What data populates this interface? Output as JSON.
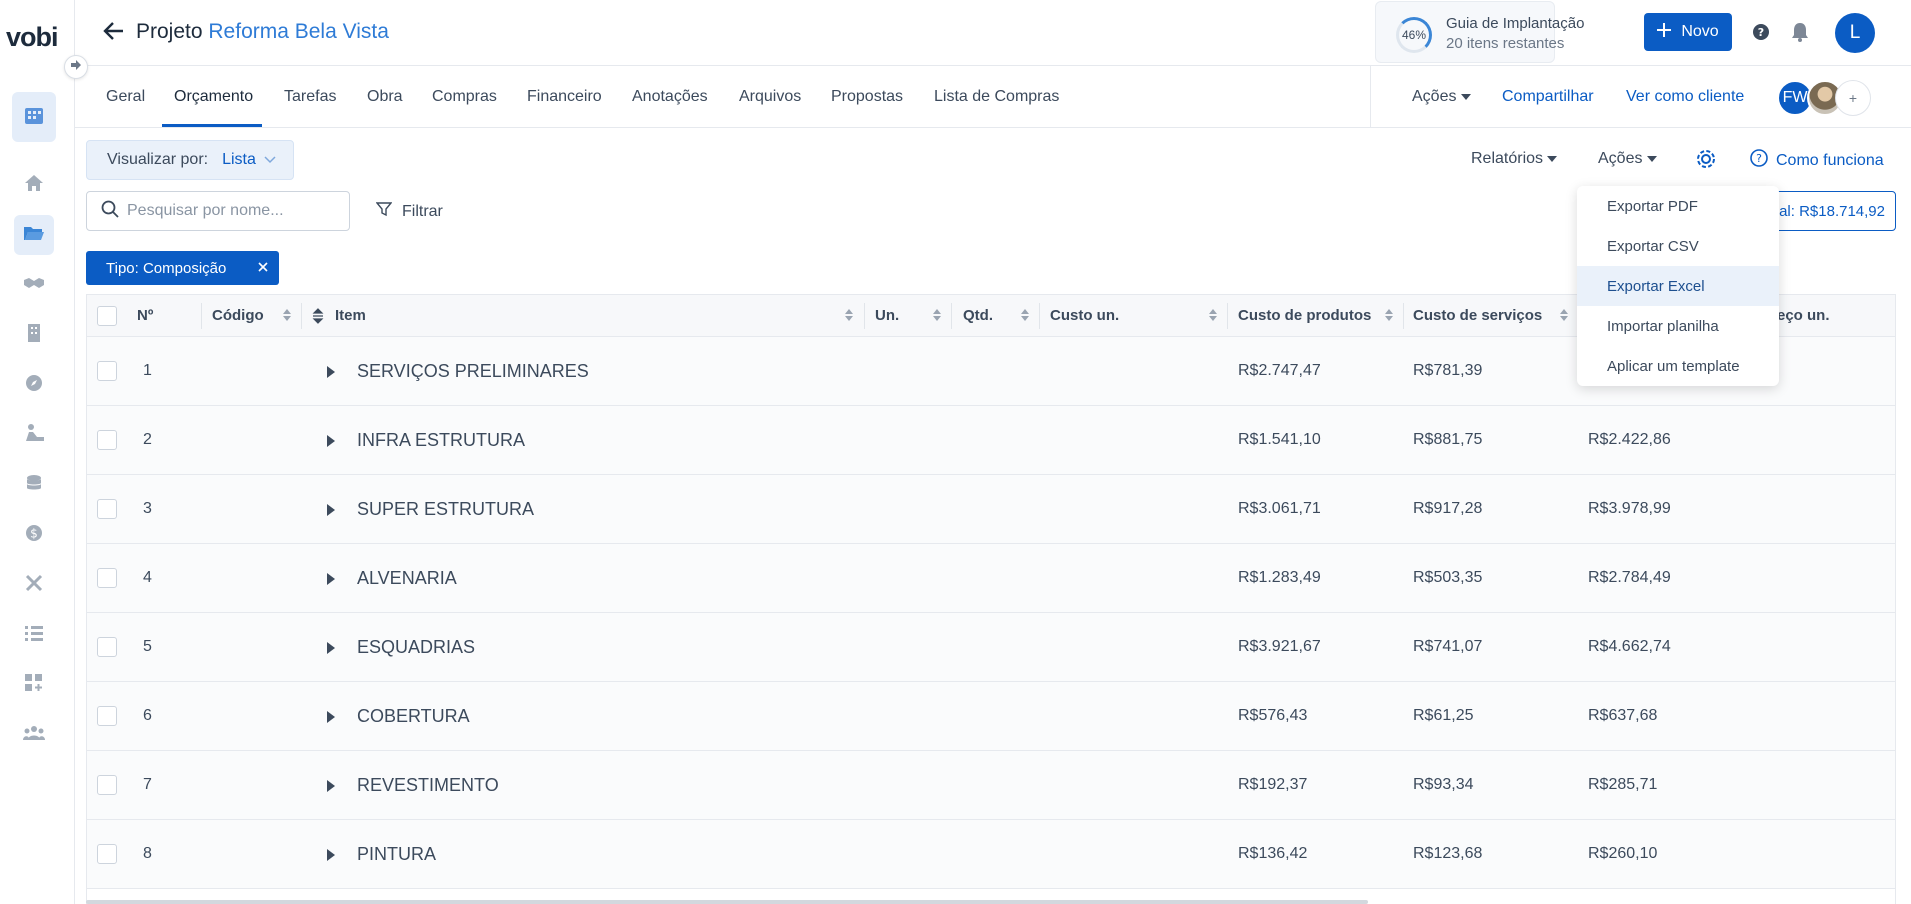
{
  "app": {
    "logo": "vobi"
  },
  "header": {
    "project_prefix": "Projeto",
    "project_name": "Reforma Bela Vista",
    "guide": {
      "percent": "46%",
      "title": "Guia de Implantação",
      "subtitle": "20 itens restantes"
    },
    "new_button": "Novo",
    "user_initial": "L"
  },
  "tabs": {
    "items": [
      "Geral",
      "Orçamento",
      "Tarefas",
      "Obra",
      "Compras",
      "Financeiro",
      "Anotações",
      "Arquivos",
      "Propostas",
      "Lista de Compras"
    ],
    "active": "Orçamento",
    "actions_label": "Ações",
    "share_label": "Compartilhar",
    "view_as_client_label": "Ver como cliente",
    "avatar_initials": "FW",
    "avatar_more": "+"
  },
  "toolbar": {
    "view_by_label": "Visualizar por:",
    "view_by_value": "Lista",
    "reports_label": "Relatórios",
    "actions_label": "Ações",
    "how_it_works": "Como funciona",
    "search_placeholder": "Pesquisar por nome...",
    "filter_label": "Filtrar",
    "total_label": "al: R$18.714,92",
    "chip_label": "Tipo: Composição"
  },
  "dropdown": {
    "items": [
      "Exportar PDF",
      "Exportar CSV",
      "Exportar Excel",
      "Importar planilha",
      "Aplicar um template"
    ],
    "highlighted": "Exportar Excel"
  },
  "table": {
    "columns": [
      "Nº",
      "Código",
      "Item",
      "Un.",
      "Qtd.",
      "Custo un.",
      "Custo de produtos",
      "Custo de serviços",
      "eço un."
    ],
    "rows": [
      {
        "n": "1",
        "name": "SERVIÇOS PRELIMINARES",
        "produtos": "R$2.747,47",
        "servicos": "R$781,39",
        "total": ""
      },
      {
        "n": "2",
        "name": "INFRA ESTRUTURA",
        "produtos": "R$1.541,10",
        "servicos": "R$881,75",
        "total": "R$2.422,86"
      },
      {
        "n": "3",
        "name": "SUPER ESTRUTURA",
        "produtos": "R$3.061,71",
        "servicos": "R$917,28",
        "total": "R$3.978,99"
      },
      {
        "n": "4",
        "name": "ALVENARIA",
        "produtos": "R$1.283,49",
        "servicos": "R$503,35",
        "total": "R$2.784,49"
      },
      {
        "n": "5",
        "name": "ESQUADRIAS",
        "produtos": "R$3.921,67",
        "servicos": "R$741,07",
        "total": "R$4.662,74"
      },
      {
        "n": "6",
        "name": "COBERTURA",
        "produtos": "R$576,43",
        "servicos": "R$61,25",
        "total": "R$637,68"
      },
      {
        "n": "7",
        "name": "REVESTIMENTO",
        "produtos": "R$192,37",
        "servicos": "R$93,34",
        "total": "R$285,71"
      },
      {
        "n": "8",
        "name": "PINTURA",
        "produtos": "R$136,42",
        "servicos": "R$123,68",
        "total": "R$260,10"
      }
    ]
  },
  "colors": {
    "primary": "#0b5cc4",
    "link": "#2e7bd6",
    "highlight": "#eaf1fa"
  }
}
